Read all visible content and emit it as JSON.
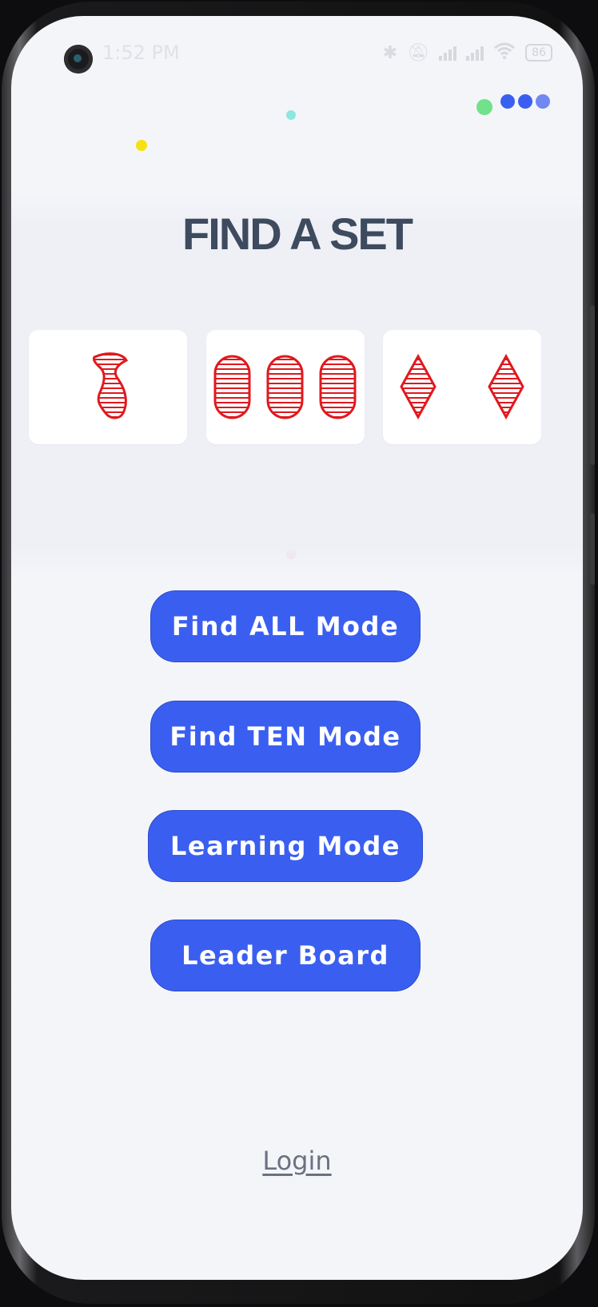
{
  "status_bar": {
    "time": "1:52 PM",
    "battery": "86",
    "icons": [
      "bluetooth-icon",
      "bell-off-icon",
      "signal-icon",
      "signal-icon",
      "wifi-icon",
      "battery-icon"
    ]
  },
  "title": "FIND A SET",
  "cards": [
    {
      "shape": "squiggle",
      "count": 1,
      "color": "#e0191e",
      "fill": "striped"
    },
    {
      "shape": "oval",
      "count": 3,
      "color": "#e0191e",
      "fill": "striped"
    },
    {
      "shape": "diamond",
      "count": 2,
      "color": "#e0191e",
      "fill": "striped"
    }
  ],
  "menu": {
    "find_all": "Find ALL Mode",
    "find_ten": "Find TEN Mode",
    "learning": "Learning Mode",
    "leader_board": "Leader Board"
  },
  "login": "Login",
  "colors": {
    "accent": "#3a5ff0",
    "background": "#f4f5f9",
    "title": "#3e4a5e",
    "card_symbol": "#e0191e"
  }
}
